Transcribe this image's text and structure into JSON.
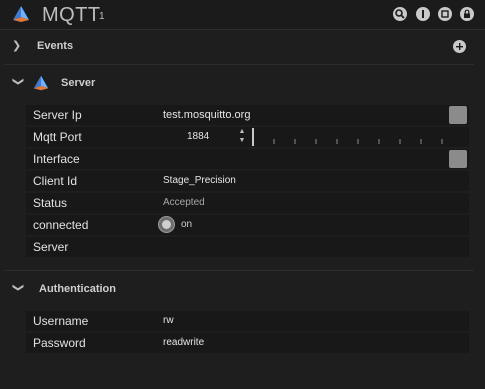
{
  "header": {
    "title": "MQTT",
    "badge": "1",
    "buttons": [
      "search-icon",
      "info-icon",
      "stop-icon",
      "lock-icon"
    ]
  },
  "events": {
    "label": "Events",
    "add_icon": "plus-circle-icon"
  },
  "server": {
    "label": "Server",
    "rows": {
      "server_ip": {
        "label": "Server Ip",
        "value": "test.mosquitto.org"
      },
      "mqtt_port": {
        "label": "Mqtt Port",
        "value": "1884"
      },
      "interface": {
        "label": "Interface",
        "value": ""
      },
      "client_id": {
        "label": "Client Id",
        "value": "Stage_Precision"
      },
      "status": {
        "label": "Status",
        "value": "Accepted"
      },
      "connected": {
        "label": "connected",
        "value": "on"
      },
      "server": {
        "label": "Server",
        "value": ""
      }
    }
  },
  "authentication": {
    "label": "Authentication",
    "rows": {
      "username": {
        "label": "Username",
        "value": "rw"
      },
      "password": {
        "label": "Password",
        "value": "readwrite"
      }
    }
  },
  "colors": {
    "background": "#1e1e1e",
    "row": "#181818",
    "button": "#8b8b8b",
    "icon_blue": "#3d7bd6",
    "icon_orange": "#e07a3a"
  }
}
